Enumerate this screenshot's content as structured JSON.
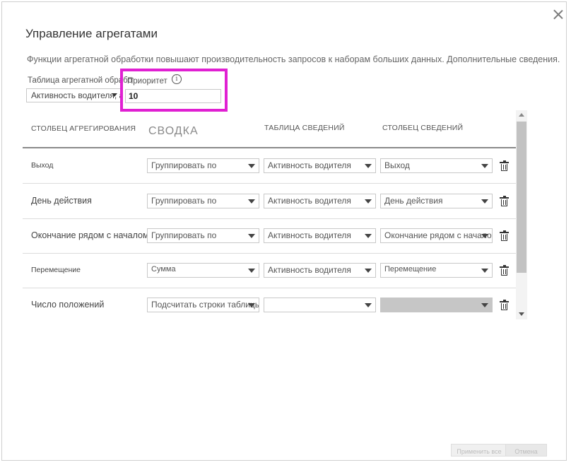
{
  "dialog": {
    "title": "Управление агрегатами",
    "description": "Функции агрегатной обработки повышают производительность запросов к наборам больших данных. Дополнительные сведения.",
    "close_icon": "close-icon"
  },
  "agg_table": {
    "label": "Таблица агрегатной обработки",
    "value": "Активность водителя, агр"
  },
  "priority": {
    "label": "Приоритет",
    "value": "10",
    "info_icon": "info-icon"
  },
  "highlight_color": "#e020d2",
  "grid": {
    "headers": {
      "agg_column": "СТОЛБЕЦ АГРЕГИРОВАНИЯ",
      "summary": "СВОДКА",
      "detail_table": "ТАБЛИЦА СВЕДЕНИЙ",
      "detail_column": "СТОЛБЕЦ СВЕДЕНИЙ"
    },
    "rows": [
      {
        "name": "Выход",
        "summary": "Группировать по",
        "detail_table": "Активность водителя",
        "detail_column": "Выход"
      },
      {
        "name": "День действия",
        "summary": "Группировать по",
        "detail_table": "Активность водителя",
        "detail_column": "День действия"
      },
      {
        "name": "Окончание рядом с началом",
        "summary": "Группировать по",
        "detail_table": "Активность водителя",
        "detail_column": "Окончание рядом с началом"
      },
      {
        "name": "Перемещение",
        "summary": "Сумма",
        "detail_table": "Активность водителя",
        "detail_column": "Перемещение"
      },
      {
        "name": "Число положений",
        "summary": "Подсчитать строки таблицы",
        "detail_table": "",
        "detail_column": ""
      }
    ]
  },
  "footer": {
    "apply_label": "Применить все",
    "cancel_label": "Отмена"
  }
}
